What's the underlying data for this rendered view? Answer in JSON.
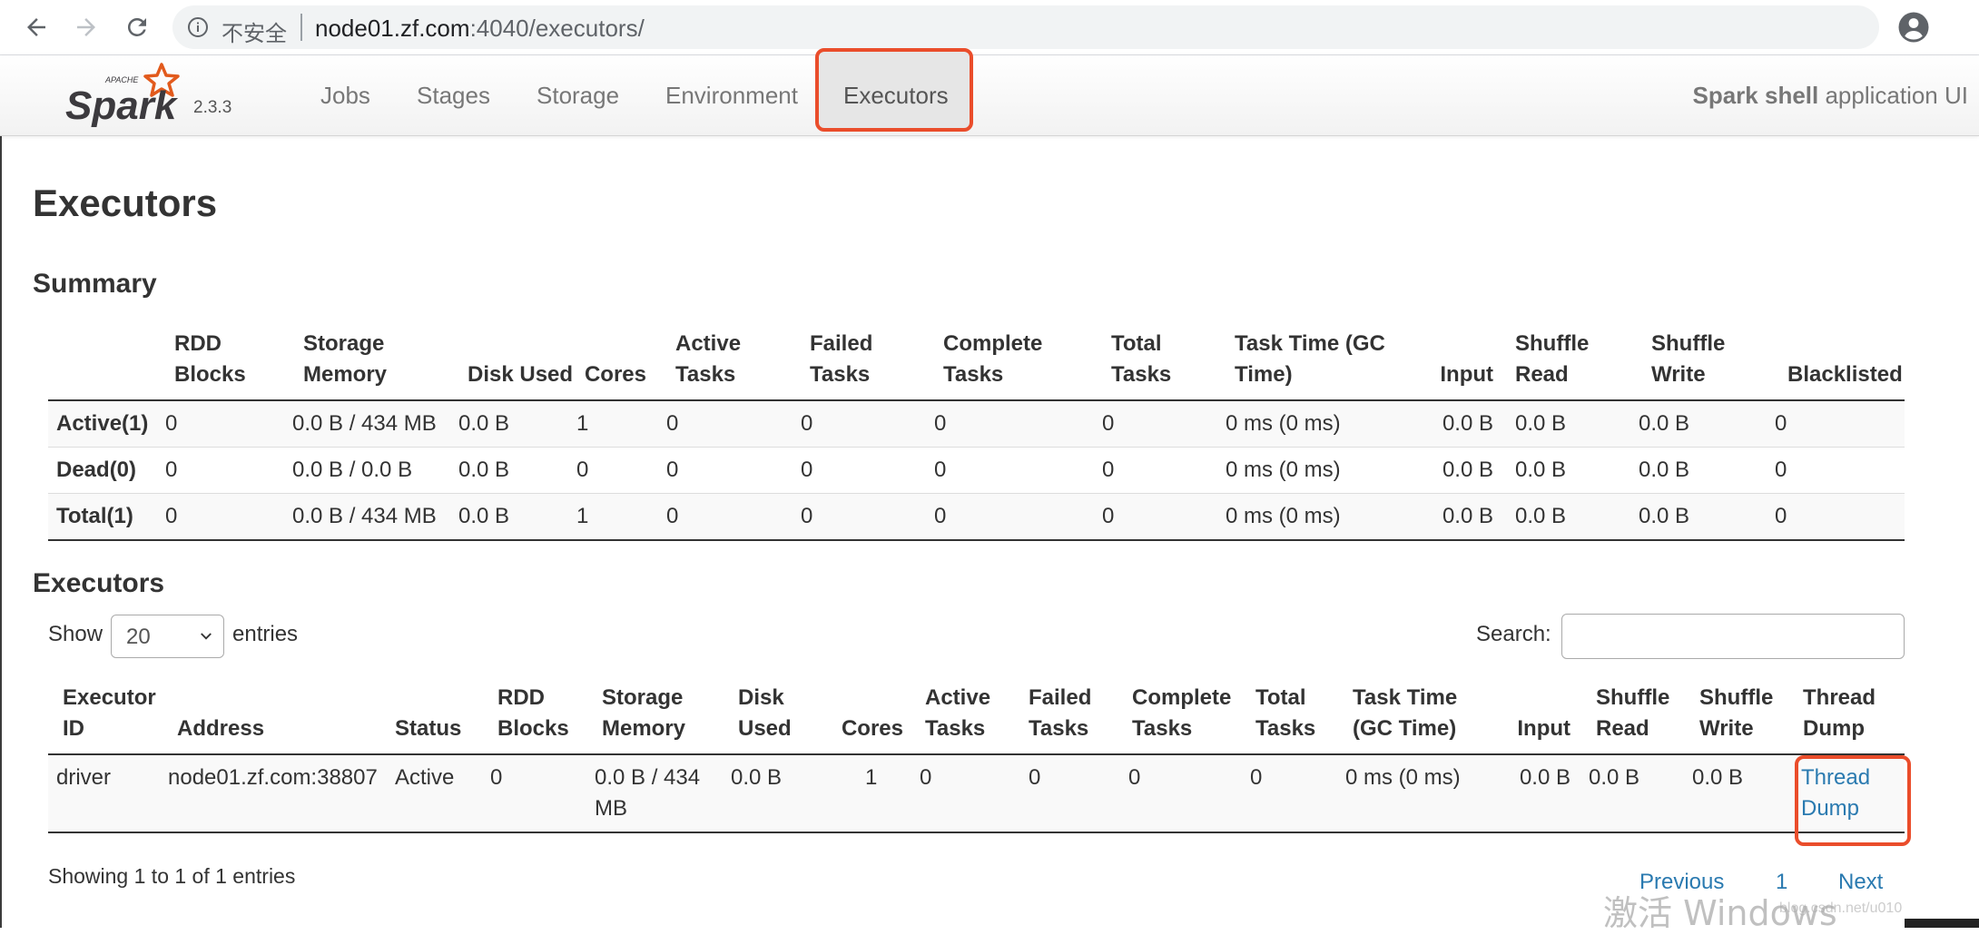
{
  "browser": {
    "security_text": "不安全",
    "url_host": "node01.zf.com",
    "url_rest": ":4040/executors/"
  },
  "header": {
    "logo_text": "Spark",
    "logo_apache": "APACHE",
    "version": "2.3.3",
    "nav": [
      {
        "label": "Jobs"
      },
      {
        "label": "Stages"
      },
      {
        "label": "Storage"
      },
      {
        "label": "Environment"
      },
      {
        "label": "Executors"
      }
    ],
    "app_name_bold": "Spark shell",
    "app_name_rest": " application UI"
  },
  "page_title": "Executors",
  "summary": {
    "title": "Summary",
    "columns": [
      "",
      "RDD Blocks",
      "Storage Memory",
      "Disk Used",
      "Cores",
      "Active Tasks",
      "Failed Tasks",
      "Complete Tasks",
      "Total Tasks",
      "Task Time (GC Time)",
      "Input",
      "Shuffle Read",
      "Shuffle Write",
      "Blacklisted"
    ],
    "rows": [
      [
        "Active(1)",
        "0",
        "0.0 B / 434 MB",
        "0.0 B",
        "1",
        "0",
        "0",
        "0",
        "0",
        "0 ms (0 ms)",
        "0.0 B",
        "0.0 B",
        "0.0 B",
        "0"
      ],
      [
        "Dead(0)",
        "0",
        "0.0 B / 0.0 B",
        "0.0 B",
        "0",
        "0",
        "0",
        "0",
        "0",
        "0 ms (0 ms)",
        "0.0 B",
        "0.0 B",
        "0.0 B",
        "0"
      ],
      [
        "Total(1)",
        "0",
        "0.0 B / 434 MB",
        "0.0 B",
        "1",
        "0",
        "0",
        "0",
        "0",
        "0 ms (0 ms)",
        "0.0 B",
        "0.0 B",
        "0.0 B",
        "0"
      ]
    ]
  },
  "executors": {
    "title": "Executors",
    "show_label": "Show",
    "page_size": "20",
    "entries_label": "entries",
    "search_label": "Search:",
    "search_value": "",
    "columns": [
      "Executor ID",
      "Address",
      "Status",
      "RDD Blocks",
      "Storage Memory",
      "Disk Used",
      "Cores",
      "Active Tasks",
      "Failed Tasks",
      "Complete Tasks",
      "Total Tasks",
      "Task Time (GC Time)",
      "Input",
      "Shuffle Read",
      "Shuffle Write",
      "Thread Dump"
    ],
    "rows": [
      [
        "driver",
        "node01.zf.com:38807",
        "Active",
        "0",
        "0.0 B / 434 MB",
        "0.0 B",
        "1",
        "0",
        "0",
        "0",
        "0",
        "0 ms (0 ms)",
        "0.0 B",
        "0.0 B",
        "0.0 B",
        "Thread Dump"
      ]
    ],
    "info": "Showing 1 to 1 of 1 entries",
    "pagination": {
      "previous": "Previous",
      "page": "1",
      "next": "Next"
    }
  },
  "overlay": {
    "watermark": "激活 Windows",
    "watermark_url": "blog.csdn.net/u010"
  },
  "colors": {
    "highlight": "#ea4d2b",
    "link": "#2a7ab0",
    "spark_orange": "#e25a1c"
  }
}
